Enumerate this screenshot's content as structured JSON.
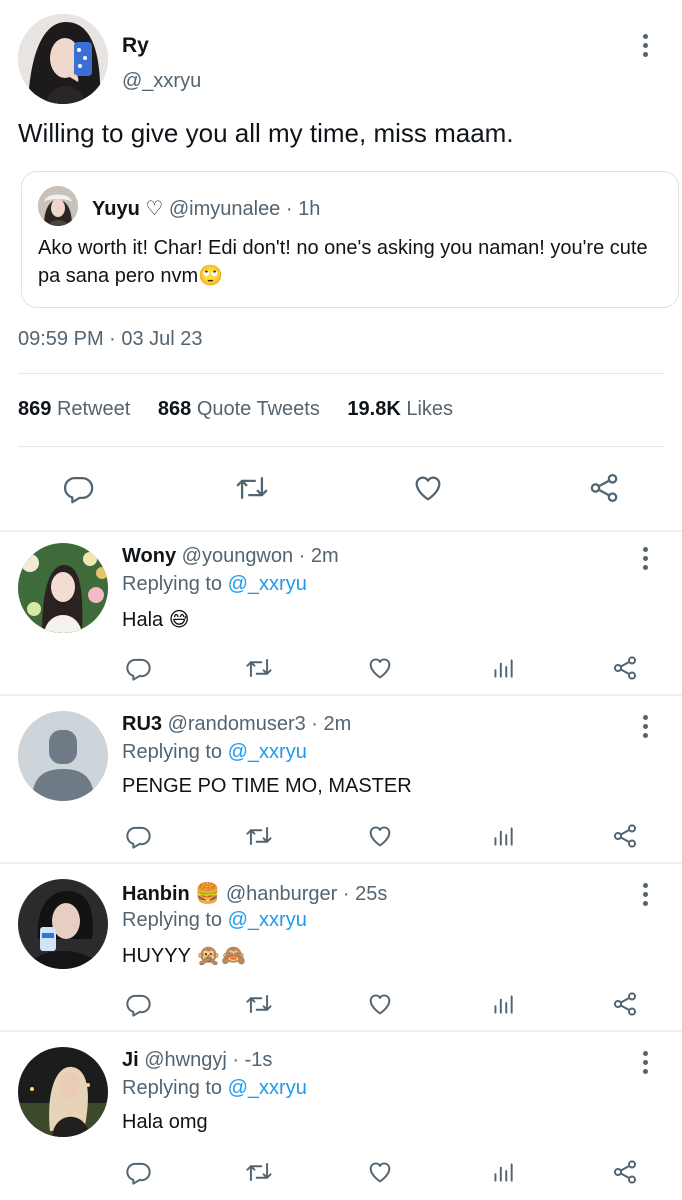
{
  "main_tweet": {
    "author_name": "Ry",
    "author_handle": "@_xxryu",
    "text": "Willing to give you all my time, miss maam.",
    "quote": {
      "name": "Yuyu ♡",
      "handle": "@imyunalee",
      "time": " · 1h",
      "text": "Ako worth it! Char! Edi don't! no one's asking you naman! you're cute pa sana pero nvm🙄"
    },
    "timestamp": "09:59 PM · 03 Jul 23",
    "stats": {
      "retweets_count": "869",
      "retweets_label": "Retweet",
      "quotes_count": "868",
      "quotes_label": "Quote Tweets",
      "likes_count": "19.8K",
      "likes_label": "Likes"
    },
    "actions": [
      "reply-icon",
      "retweet-icon",
      "like-icon",
      "share-icon"
    ]
  },
  "replies": [
    {
      "name": "Wony",
      "emoji": "",
      "handle": "@youngwon",
      "time": " · 2m",
      "replying_prefix": "Replying to ",
      "replying_handle": "@_xxryu",
      "text": "Hala 😅"
    },
    {
      "name": "RU3",
      "emoji": "",
      "handle": "@randomuser3",
      "time": " · 2m",
      "replying_prefix": "Replying to ",
      "replying_handle": "@_xxryu",
      "text": "PENGE PO TIME MO, MASTER"
    },
    {
      "name": "Hanbin",
      "emoji": "🍔",
      "handle": "@hanburger",
      "time": " · 25s",
      "replying_prefix": "Replying to ",
      "replying_handle": "@_xxryu",
      "text": "HUYYY 🙊🙈"
    },
    {
      "name": "Ji",
      "emoji": "",
      "handle": "@hwngyj",
      "time": " · -1s",
      "replying_prefix": "Replying to ",
      "replying_handle": "@_xxryu",
      "text": "Hala omg"
    }
  ],
  "colors": {
    "text_primary": "#0f1419",
    "text_secondary": "#536471",
    "link": "#1d9bf0",
    "divider": "#e3e7ea"
  }
}
